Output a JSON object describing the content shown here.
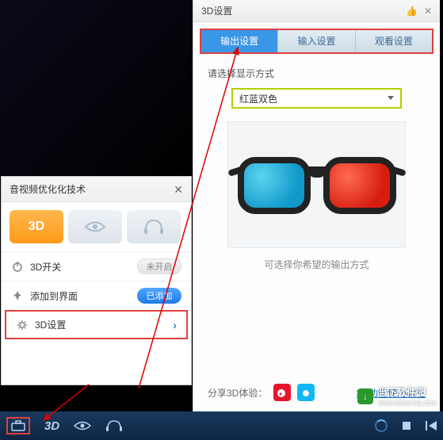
{
  "leftPanel": {
    "title": "音视频优化化技术",
    "icons": {
      "threeD": "3D"
    },
    "rows": {
      "power": {
        "label": "3D开关",
        "status": "未开启"
      },
      "pin": {
        "label": "添加到界面",
        "status": "已添加"
      },
      "settings": {
        "label": "3D设置"
      }
    }
  },
  "rightPanel": {
    "title": "3D设置",
    "tabs": {
      "output": "输出设置",
      "input": "输入设置",
      "view": "观看设置"
    },
    "prompt": "请选择显示方式",
    "selectValue": "红蓝双色",
    "description": "可选择你希望的输出方式",
    "footer": {
      "shareLabel": "分享3D体验：",
      "tutorialLink": "3D功能使用教程"
    }
  },
  "bottomBar": {
    "threeD": "3D"
  },
  "watermark": {
    "text": "当下软件园",
    "url": "www.downxia.com"
  }
}
